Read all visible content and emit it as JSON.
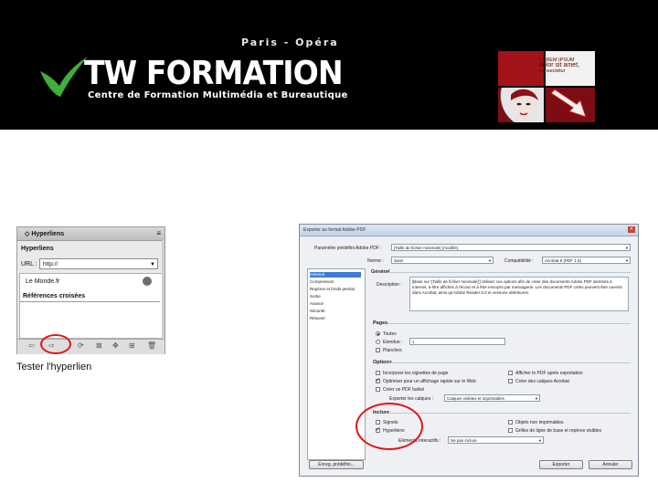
{
  "header": {
    "city_line": "Paris - Opéra",
    "brand": "TW FORMATION",
    "tagline": "Centre de Formation Multimédia et Bureautique",
    "promo_lines": [
      "LOREM IPSUM",
      "dolor sit amet,",
      "consectetur"
    ]
  },
  "panel": {
    "tab_label": "◇ Hyperliens",
    "menu_glyph": "≡",
    "section_title": "Hyperliens",
    "url_label": "URL :",
    "url_value": "http://",
    "link_item": "Le Monde.fr",
    "references_title": "Références croisées",
    "footer_icons": [
      "⇦",
      "⇨",
      "⟳",
      "⊠",
      "✥",
      "⊞",
      "🗑"
    ]
  },
  "caption": "Tester l'hyperlien",
  "dialog": {
    "title": "Exporter au format Adobe PDF",
    "preset_label": "Paramètre prédéfini Adobe PDF :",
    "preset_value": "[Taille de fichier minimale] (modifié)",
    "norm_label": "Norme :",
    "norm_value": "Sans",
    "compat_label": "Compatibilité :",
    "compat_value": "Acrobat 6 (PDF 1.5)",
    "sidebar_items": [
      "Général",
      "Compression",
      "Repères et fonds perdus",
      "Sortie",
      "Avancé",
      "Sécurité",
      "Résumé"
    ],
    "general_title": "Général",
    "desc_label": "Description :",
    "description": "[Basé sur '[Taille de fichier minimale]'] Utilisez ces options afin de créer des documents Adobe PDF destinés à Internet, à être affichés à l'écran et à être envoyés par messagerie. Les documents PDF créés peuvent être ouverts dans Acrobat, ainsi qu'Adobe Reader 6.0 et versions ultérieures.",
    "pages_title": "Pages",
    "pages_all": "Toutes",
    "pages_range_label": "Etendue :",
    "pages_range_value": "1",
    "spreads": "Planches",
    "options_title": "Options",
    "opt_thumbs": "Incorporer les vignettes de page",
    "opt_web": "Optimiser pour un affichage rapide sur le Web",
    "opt_tagged": "Créer un PDF balisé",
    "opt_view": "Afficher le PDF après exportation",
    "opt_layers": "Créer des calques Acrobat",
    "export_layers_label": "Exporter les calques :",
    "export_layers_value": "Calques visibles et imprimables",
    "include_title": "Inclure",
    "inc_bookmarks": "Signets",
    "inc_hyperlinks": "Hyperliens",
    "inc_nonprint": "Objets non imprimables",
    "inc_guides": "Grilles de ligne de base et repères visibles",
    "interactive_label": "Eléments interactifs :",
    "interactive_value": "Ne pas inclure",
    "btn_save": "Enreg. prédéfini...",
    "btn_export": "Exporter",
    "btn_cancel": "Annuler"
  },
  "colors": {
    "highlight_circle": "#e0161b",
    "header_bg": "#000000",
    "brand_green": "#3fae3a",
    "promo_red": "#a3131a"
  }
}
